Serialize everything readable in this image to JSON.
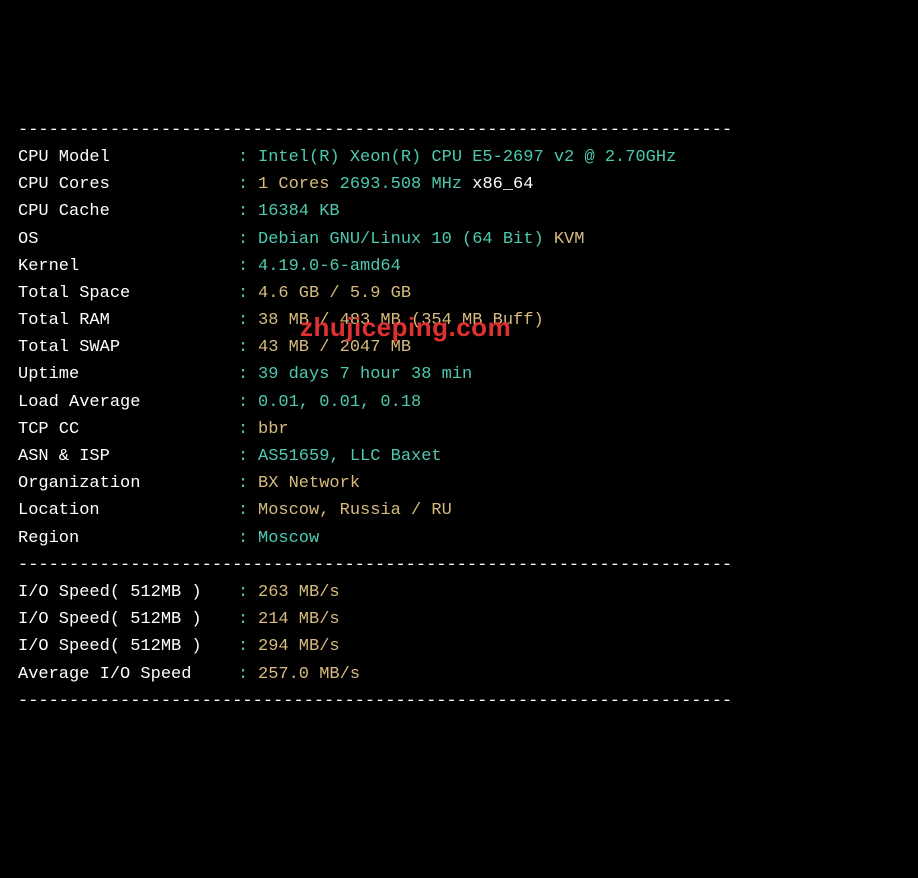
{
  "divider": "----------------------------------------------------------------------",
  "rows": [
    {
      "label": "CPU Model",
      "segments": [
        {
          "text": "Intel(R) Xeon(R) CPU E5-2697 v2 @ 2.70GHz",
          "color": "cyan"
        }
      ]
    },
    {
      "label": "CPU Cores",
      "segments": [
        {
          "text": "1 Cores ",
          "color": "yellow"
        },
        {
          "text": "2693.508 MHz ",
          "color": "cyan"
        },
        {
          "text": "x86_64",
          "color": "white"
        }
      ]
    },
    {
      "label": "CPU Cache",
      "segments": [
        {
          "text": "16384 KB",
          "color": "cyan"
        }
      ]
    },
    {
      "label": "OS",
      "segments": [
        {
          "text": "Debian GNU/Linux 10 (64 Bit) ",
          "color": "cyan"
        },
        {
          "text": "KVM",
          "color": "yellow"
        }
      ]
    },
    {
      "label": "Kernel",
      "segments": [
        {
          "text": "4.19.0-6-amd64",
          "color": "cyan"
        }
      ]
    },
    {
      "label": "Total Space",
      "segments": [
        {
          "text": "4.6 GB / 5.9 GB",
          "color": "yellow"
        }
      ]
    },
    {
      "label": "Total RAM",
      "segments": [
        {
          "text": "38 MB / 483 MB (354 MB Buff)",
          "color": "yellow"
        }
      ]
    },
    {
      "label": "Total SWAP",
      "segments": [
        {
          "text": "43 MB / 2047 MB",
          "color": "yellow"
        }
      ]
    },
    {
      "label": "Uptime",
      "segments": [
        {
          "text": "39 days 7 hour 38 min",
          "color": "cyan"
        }
      ]
    },
    {
      "label": "Load Average",
      "segments": [
        {
          "text": "0.01, 0.01, 0.18",
          "color": "cyan"
        }
      ]
    },
    {
      "label": "TCP CC",
      "segments": [
        {
          "text": "bbr",
          "color": "yellow"
        }
      ]
    },
    {
      "label": "ASN & ISP",
      "segments": [
        {
          "text": "AS51659, LLC Baxet",
          "color": "cyan"
        }
      ]
    },
    {
      "label": "Organization",
      "segments": [
        {
          "text": "BX Network",
          "color": "yellow"
        }
      ]
    },
    {
      "label": "Location",
      "segments": [
        {
          "text": "Moscow, Russia / RU",
          "color": "yellow"
        }
      ]
    },
    {
      "label": "Region",
      "segments": [
        {
          "text": "Moscow",
          "color": "cyan"
        }
      ]
    }
  ],
  "io_rows": [
    {
      "label": "I/O Speed( 512MB )",
      "segments": [
        {
          "text": "263 MB/s",
          "color": "yellow"
        }
      ]
    },
    {
      "label": "I/O Speed( 512MB )",
      "segments": [
        {
          "text": "214 MB/s",
          "color": "yellow"
        }
      ]
    },
    {
      "label": "I/O Speed( 512MB )",
      "segments": [
        {
          "text": "294 MB/s",
          "color": "yellow"
        }
      ]
    },
    {
      "label": "Average I/O Speed",
      "segments": [
        {
          "text": "257.0 MB/s",
          "color": "yellow"
        }
      ]
    }
  ],
  "watermark": "zhujiceping.com"
}
